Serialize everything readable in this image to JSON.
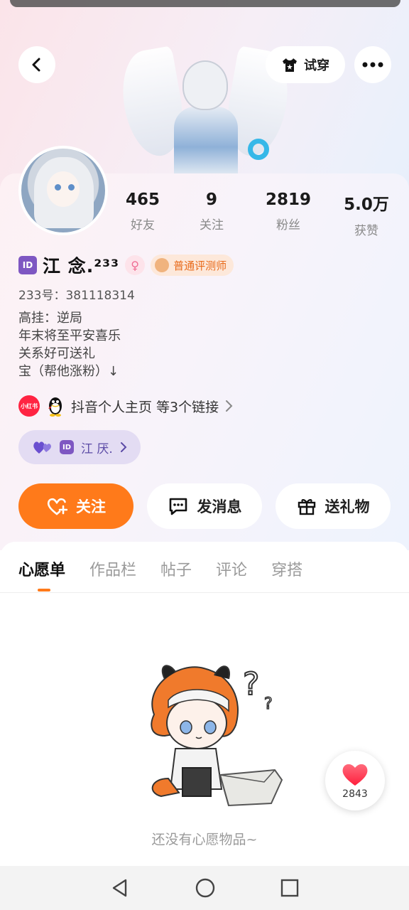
{
  "header": {
    "try_on_label": "试穿"
  },
  "stats": [
    {
      "value": "465",
      "label": "好友"
    },
    {
      "value": "9",
      "label": "关注"
    },
    {
      "value": "2819",
      "label": "粉丝"
    },
    {
      "value": "5.0万",
      "label": "获赞"
    }
  ],
  "profile": {
    "name": "江 念.²³³",
    "role_tag": "普通评测师",
    "uid": "233号：381118314",
    "bio": [
      "高挂：逆局",
      "年末将至平安喜乐",
      "关系好可送礼",
      "宝（帮他涨粉）↓"
    ],
    "links_text": "抖音个人主页 等3个链接",
    "xhs_label": "小红书",
    "cp_name": "江 厌."
  },
  "actions": {
    "follow": "关注",
    "message": "发消息",
    "gift": "送礼物"
  },
  "tabs": [
    "心愿单",
    "作品栏",
    "帖子",
    "评论",
    "穿搭"
  ],
  "empty_state": "还没有心愿物品~",
  "like_count": "2843",
  "colors": {
    "accent": "#ff7a1a",
    "cp_pill": "#e3dcf3",
    "heart": "#ff2f4d"
  }
}
